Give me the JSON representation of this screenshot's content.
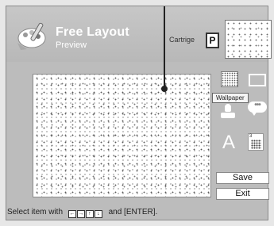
{
  "header": {
    "title": "Free Layout",
    "subtitle": "Preview",
    "cartridge_label": "Cartrige",
    "cartridge_letter": "P"
  },
  "tools": {
    "wallpaper_tooltip": "Wallpaper",
    "text_tool_glyph": "A",
    "speech_glyph": "•••",
    "calendar_number": "3",
    "items": [
      "wallpaper-icon",
      "frame-icon",
      "stamp-icon",
      "speech-bubble-icon",
      "text-icon",
      "calendar-icon"
    ]
  },
  "buttons": {
    "save_label": "Save",
    "exit_label": "Exit"
  },
  "status": {
    "prefix": "Select item with",
    "keys": [
      "←",
      "→",
      "↑",
      "↓"
    ],
    "suffix": "and [ENTER]."
  },
  "colors": {
    "background": "#bcbcbc",
    "header_text": "#ffffff"
  }
}
